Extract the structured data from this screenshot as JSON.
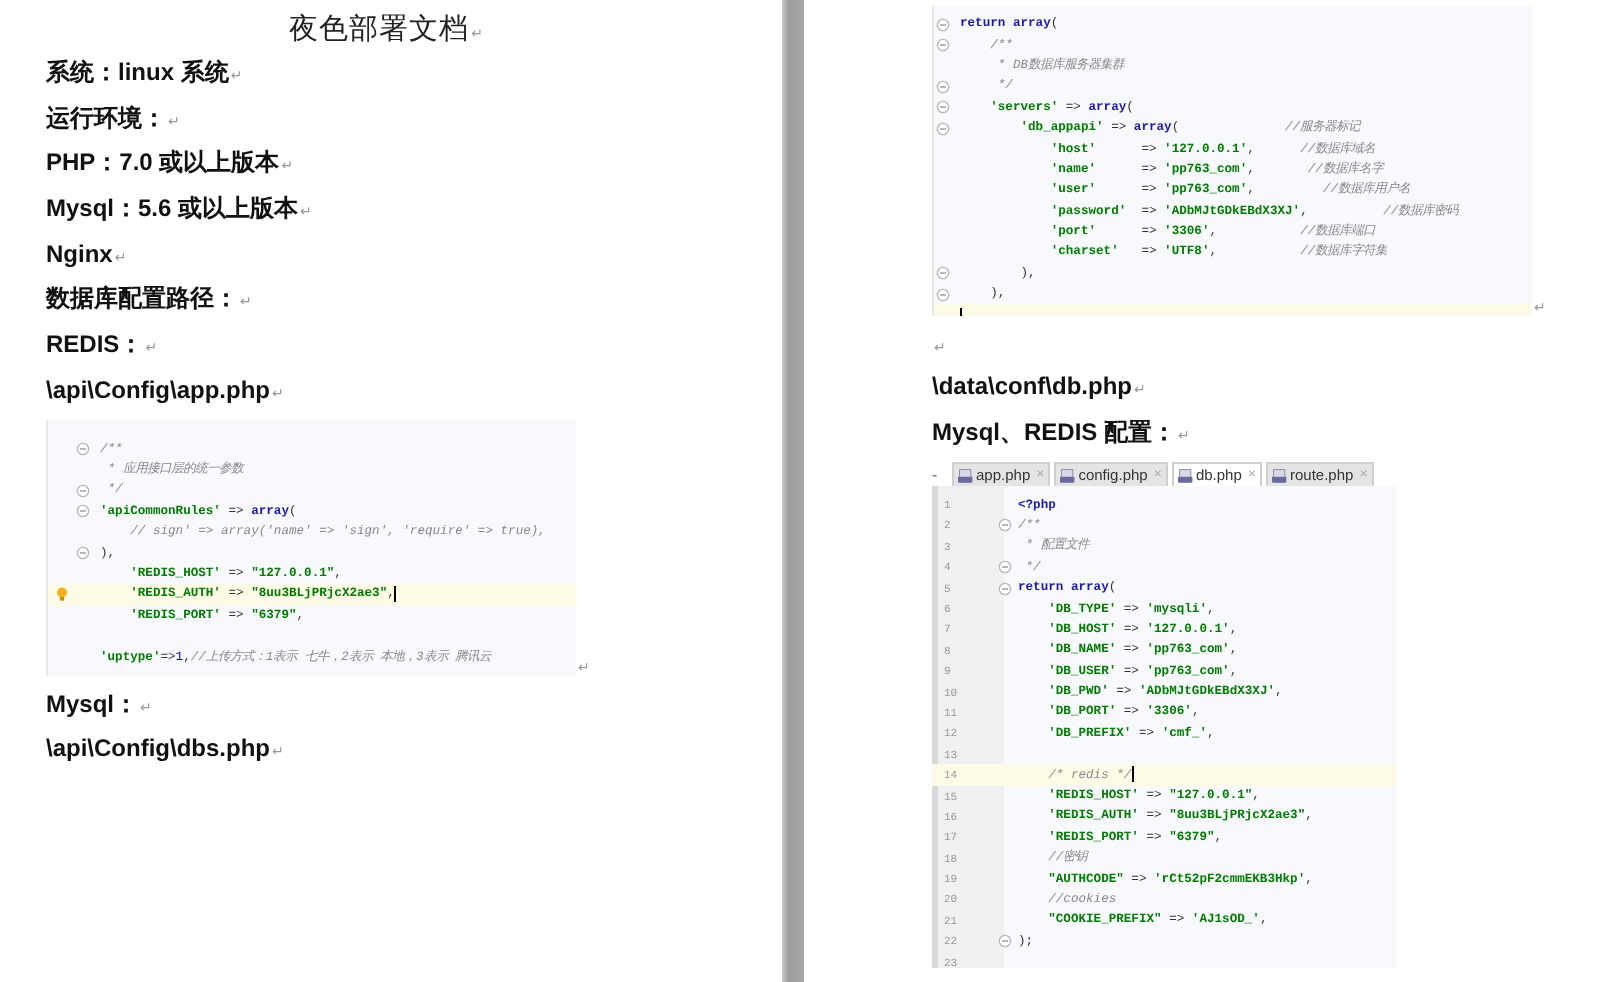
{
  "left_page": {
    "title": {
      "text": "夜色部署文档",
      "mark": "↵"
    },
    "paragraphs_top": [
      {
        "text": "系统：linux 系统",
        "mark": "↵"
      },
      {
        "text": "运行环境：",
        "mark": "↵"
      },
      {
        "text": "PHP：7.0 或以上版本",
        "mark": "↵"
      },
      {
        "text": "Mysql：5.6 或以上版本",
        "mark": "↵"
      },
      {
        "text": "Nginx",
        "mark": "↵"
      },
      {
        "text": "数据库配置路径：",
        "mark": "↵"
      },
      {
        "text": "REDIS：",
        "mark": "↵"
      },
      {
        "text": "\\api\\Config\\app.php",
        "mark": "↵"
      }
    ],
    "code_snippet": {
      "mark": "↵",
      "lines": [
        {
          "segments": [
            {
              "kind": "comment",
              "text": "/**"
            }
          ],
          "fold": true,
          "current": false,
          "bulb": false
        },
        {
          "segments": [
            {
              "kind": "comment",
              "text": " * 应用接口层的统一参数"
            }
          ],
          "fold": false,
          "current": false,
          "bulb": false
        },
        {
          "segments": [
            {
              "kind": "comment",
              "text": " */"
            }
          ],
          "fold": true,
          "current": false,
          "bulb": false
        },
        {
          "segments": [
            {
              "kind": "string",
              "text": "'apiCommonRules'"
            },
            {
              "kind": "plain",
              "text": " => "
            },
            {
              "kind": "keyword",
              "text": "array"
            },
            {
              "kind": "plain",
              "text": "("
            }
          ],
          "fold": true,
          "current": false,
          "bulb": false
        },
        {
          "segments": [
            {
              "kind": "comment",
              "text": "    // sign' => array('name' => 'sign', 'require' => true),"
            }
          ],
          "fold": false,
          "current": false,
          "bulb": false
        },
        {
          "segments": [
            {
              "kind": "plain",
              "text": "),"
            }
          ],
          "fold": true,
          "current": false,
          "bulb": false
        },
        {
          "segments": [
            {
              "kind": "string",
              "text": "    'REDIS_HOST'"
            },
            {
              "kind": "plain",
              "text": " => "
            },
            {
              "kind": "string",
              "text": "\"127.0.0.1\""
            },
            {
              "kind": "plain",
              "text": ","
            }
          ],
          "fold": false,
          "current": false,
          "bulb": false
        },
        {
          "segments": [
            {
              "kind": "string",
              "text": "    'REDIS_AUTH'"
            },
            {
              "kind": "plain",
              "text": " => "
            },
            {
              "kind": "string",
              "text": "\"8uu3BLjPRjcX2ae3\""
            },
            {
              "kind": "plain",
              "text": ","
            }
          ],
          "fold": false,
          "current": true,
          "bulb": true
        },
        {
          "segments": [
            {
              "kind": "string",
              "text": "    'REDIS_PORT'"
            },
            {
              "kind": "plain",
              "text": " => "
            },
            {
              "kind": "string",
              "text": "\"6379\""
            },
            {
              "kind": "plain",
              "text": ","
            }
          ],
          "fold": false,
          "current": false,
          "bulb": false
        },
        {
          "fold": false,
          "current": false,
          "bulb": false
        },
        {
          "segments": [
            {
              "kind": "string",
              "text": "'uptype'"
            },
            {
              "kind": "plain",
              "text": "=>"
            },
            {
              "kind": "number",
              "text": "1"
            },
            {
              "kind": "plain",
              "text": ","
            },
            {
              "kind": "comment",
              "text": "//上传方式：1表示 七牛，2表示 本地，3表示 腾讯云"
            }
          ],
          "fold": false,
          "current": false,
          "bulb": false
        }
      ]
    },
    "paragraphs_bottom": [
      {
        "text": "Mysql：",
        "mark": "↵"
      },
      {
        "text": "\\api\\Config\\dbs.php",
        "mark": "↵"
      }
    ]
  },
  "right_page": {
    "code_snippet": {
      "mark": "↵",
      "lines": [
        {
          "segments": [
            {
              "kind": "keyword",
              "text": "return array"
            },
            {
              "kind": "plain",
              "text": "("
            }
          ],
          "fold": true,
          "current": false
        },
        {
          "segments": [
            {
              "kind": "comment",
              "text": "    /**"
            }
          ],
          "fold": true,
          "current": false
        },
        {
          "segments": [
            {
              "kind": "comment",
              "text": "     * DB数据库服务器集群"
            }
          ],
          "fold": false,
          "current": false
        },
        {
          "segments": [
            {
              "kind": "comment",
              "text": "     */"
            }
          ],
          "fold": true,
          "current": false
        },
        {
          "segments": [
            {
              "kind": "string",
              "text": "    'servers'"
            },
            {
              "kind": "plain",
              "text": " => "
            },
            {
              "kind": "keyword",
              "text": "array"
            },
            {
              "kind": "plain",
              "text": "("
            }
          ],
          "fold": true,
          "current": false
        },
        {
          "segments": [
            {
              "kind": "string",
              "text": "        'db_appapi'"
            },
            {
              "kind": "plain",
              "text": " => "
            },
            {
              "kind": "keyword",
              "text": "array"
            },
            {
              "kind": "plain",
              "text": "(              "
            },
            {
              "kind": "comment",
              "text": "//服务器标记"
            }
          ],
          "fold": true,
          "current": false
        },
        {
          "segments": [
            {
              "kind": "string",
              "text": "            'host'"
            },
            {
              "kind": "plain",
              "text": "      => "
            },
            {
              "kind": "string",
              "text": "'127.0.0.1'"
            },
            {
              "kind": "plain",
              "text": ",      "
            },
            {
              "kind": "comment",
              "text": "//数据库域名"
            }
          ],
          "fold": false,
          "current": false
        },
        {
          "segments": [
            {
              "kind": "string",
              "text": "            'name'"
            },
            {
              "kind": "plain",
              "text": "      => "
            },
            {
              "kind": "string",
              "text": "'pp763_com'"
            },
            {
              "kind": "plain",
              "text": ",       "
            },
            {
              "kind": "comment",
              "text": "//数据库名字"
            }
          ],
          "fold": false,
          "current": false
        },
        {
          "segments": [
            {
              "kind": "string",
              "text": "            'user'"
            },
            {
              "kind": "plain",
              "text": "      => "
            },
            {
              "kind": "string",
              "text": "'pp763_com'"
            },
            {
              "kind": "plain",
              "text": ",         "
            },
            {
              "kind": "comment",
              "text": "//数据库用户名"
            }
          ],
          "fold": false,
          "current": false
        },
        {
          "segments": [
            {
              "kind": "string",
              "text": "            'password'"
            },
            {
              "kind": "plain",
              "text": "  => "
            },
            {
              "kind": "string",
              "text": "'ADbMJtGDkEBdX3XJ'"
            },
            {
              "kind": "plain",
              "text": ",          "
            },
            {
              "kind": "comment",
              "text": "//数据库密码"
            }
          ],
          "fold": false,
          "current": false
        },
        {
          "segments": [
            {
              "kind": "string",
              "text": "            'port'"
            },
            {
              "kind": "plain",
              "text": "      => "
            },
            {
              "kind": "string",
              "text": "'3306'"
            },
            {
              "kind": "plain",
              "text": ",           "
            },
            {
              "kind": "comment",
              "text": "//数据库端口"
            }
          ],
          "fold": false,
          "current": false
        },
        {
          "segments": [
            {
              "kind": "string",
              "text": "            'charset'"
            },
            {
              "kind": "plain",
              "text": "   => "
            },
            {
              "kind": "string",
              "text": "'UTF8'"
            },
            {
              "kind": "plain",
              "text": ",           "
            },
            {
              "kind": "comment",
              "text": "//数据库字符集"
            }
          ],
          "fold": false,
          "current": false
        },
        {
          "segments": [
            {
              "kind": "plain",
              "text": "        ),"
            }
          ],
          "fold": true,
          "current": false
        },
        {
          "segments": [
            {
              "kind": "plain",
              "text": "    ),"
            }
          ],
          "fold": true,
          "current": false
        },
        {
          "fold": false,
          "current": true
        }
      ]
    },
    "empty_paragraph": {
      "mark": "↵"
    },
    "paragraphs": [
      {
        "text": "\\data\\conf\\db.php",
        "mark": "↵"
      },
      {
        "text": "Mysql、REDIS 配置：",
        "mark": "↵"
      }
    ],
    "ide": {
      "collapse": "-",
      "tabs": [
        {
          "label": "app.php",
          "close": "×",
          "selected": false
        },
        {
          "label": "config.php",
          "close": "×",
          "selected": false
        },
        {
          "label": "db.php",
          "close": "×",
          "selected": true
        },
        {
          "label": "route.php",
          "close": "×",
          "selected": false
        }
      ],
      "lines": [
        {
          "n": "1",
          "segments": [
            {
              "kind": "keyword",
              "text": "<?php"
            }
          ],
          "fold": false,
          "current": false
        },
        {
          "n": "2",
          "segments": [
            {
              "kind": "comment",
              "text": "/**"
            }
          ],
          "fold": true,
          "current": false
        },
        {
          "n": "3",
          "segments": [
            {
              "kind": "comment",
              "text": " * 配置文件"
            }
          ],
          "fold": false,
          "current": false
        },
        {
          "n": "4",
          "segments": [
            {
              "kind": "comment",
              "text": " */"
            }
          ],
          "fold": true,
          "current": false
        },
        {
          "n": "5",
          "segments": [
            {
              "kind": "keyword",
              "text": "return array"
            },
            {
              "kind": "plain",
              "text": "("
            }
          ],
          "fold": true,
          "current": false
        },
        {
          "n": "6",
          "segments": [
            {
              "kind": "string",
              "text": "    'DB_TYPE'"
            },
            {
              "kind": "plain",
              "text": " => "
            },
            {
              "kind": "string",
              "text": "'mysqli'"
            },
            {
              "kind": "plain",
              "text": ","
            }
          ],
          "fold": false,
          "current": false
        },
        {
          "n": "7",
          "segments": [
            {
              "kind": "string",
              "text": "    'DB_HOST'"
            },
            {
              "kind": "plain",
              "text": " => "
            },
            {
              "kind": "string",
              "text": "'127.0.0.1'"
            },
            {
              "kind": "plain",
              "text": ","
            }
          ],
          "fold": false,
          "current": false
        },
        {
          "n": "8",
          "segments": [
            {
              "kind": "string",
              "text": "    'DB_NAME'"
            },
            {
              "kind": "plain",
              "text": " => "
            },
            {
              "kind": "string",
              "text": "'pp763_com'"
            },
            {
              "kind": "plain",
              "text": ","
            }
          ],
          "fold": false,
          "current": false
        },
        {
          "n": "9",
          "segments": [
            {
              "kind": "string",
              "text": "    'DB_USER'"
            },
            {
              "kind": "plain",
              "text": " => "
            },
            {
              "kind": "string",
              "text": "'pp763_com'"
            },
            {
              "kind": "plain",
              "text": ","
            }
          ],
          "fold": false,
          "current": false
        },
        {
          "n": "10",
          "segments": [
            {
              "kind": "string",
              "text": "    'DB_PWD'"
            },
            {
              "kind": "plain",
              "text": " => "
            },
            {
              "kind": "string",
              "text": "'ADbMJtGDkEBdX3XJ'"
            },
            {
              "kind": "plain",
              "text": ","
            }
          ],
          "fold": false,
          "current": false
        },
        {
          "n": "11",
          "segments": [
            {
              "kind": "string",
              "text": "    'DB_PORT'"
            },
            {
              "kind": "plain",
              "text": " => "
            },
            {
              "kind": "string",
              "text": "'3306'"
            },
            {
              "kind": "plain",
              "text": ","
            }
          ],
          "fold": false,
          "current": false
        },
        {
          "n": "12",
          "segments": [
            {
              "kind": "string",
              "text": "    'DB_PREFIX'"
            },
            {
              "kind": "plain",
              "text": " => "
            },
            {
              "kind": "string",
              "text": "'cmf_'"
            },
            {
              "kind": "plain",
              "text": ","
            }
          ],
          "fold": false,
          "current": false
        },
        {
          "n": "13",
          "fold": false,
          "current": false
        },
        {
          "n": "14",
          "segments": [
            {
              "kind": "comment",
              "text": "    /* redis */"
            }
          ],
          "fold": false,
          "current": true
        },
        {
          "n": "15",
          "segments": [
            {
              "kind": "string",
              "text": "    'REDIS_HOST'"
            },
            {
              "kind": "plain",
              "text": " => "
            },
            {
              "kind": "string",
              "text": "\"127.0.0.1\""
            },
            {
              "kind": "plain",
              "text": ","
            }
          ],
          "fold": false,
          "current": false
        },
        {
          "n": "16",
          "segments": [
            {
              "kind": "string",
              "text": "    'REDIS_AUTH'"
            },
            {
              "kind": "plain",
              "text": " => "
            },
            {
              "kind": "string",
              "text": "\"8uu3BLjPRjcX2ae3\""
            },
            {
              "kind": "plain",
              "text": ","
            }
          ],
          "fold": false,
          "current": false
        },
        {
          "n": "17",
          "segments": [
            {
              "kind": "string",
              "text": "    'REDIS_PORT'"
            },
            {
              "kind": "plain",
              "text": " => "
            },
            {
              "kind": "string",
              "text": "\"6379\""
            },
            {
              "kind": "plain",
              "text": ","
            }
          ],
          "fold": false,
          "current": false
        },
        {
          "n": "18",
          "segments": [
            {
              "kind": "comment",
              "text": "    //密钥"
            }
          ],
          "fold": false,
          "current": false
        },
        {
          "n": "19",
          "segments": [
            {
              "kind": "string",
              "text": "    \"AUTHCODE\""
            },
            {
              "kind": "plain",
              "text": " => "
            },
            {
              "kind": "string",
              "text": "'rCt52pF2cmmEKB3Hkp'"
            },
            {
              "kind": "plain",
              "text": ","
            }
          ],
          "fold": false,
          "current": false
        },
        {
          "n": "20",
          "segments": [
            {
              "kind": "comment",
              "text": "    //cookies"
            }
          ],
          "fold": false,
          "current": false
        },
        {
          "n": "21",
          "segments": [
            {
              "kind": "string",
              "text": "    \"COOKIE_PREFIX\""
            },
            {
              "kind": "plain",
              "text": " => "
            },
            {
              "kind": "string",
              "text": "'AJ1sOD_'"
            },
            {
              "kind": "plain",
              "text": ","
            }
          ],
          "fold": false,
          "current": false
        },
        {
          "n": "22",
          "segments": [
            {
              "kind": "plain",
              "text": ");"
            }
          ],
          "fold": true,
          "current": false
        },
        {
          "n": "23",
          "fold": false,
          "current": false
        }
      ]
    }
  }
}
